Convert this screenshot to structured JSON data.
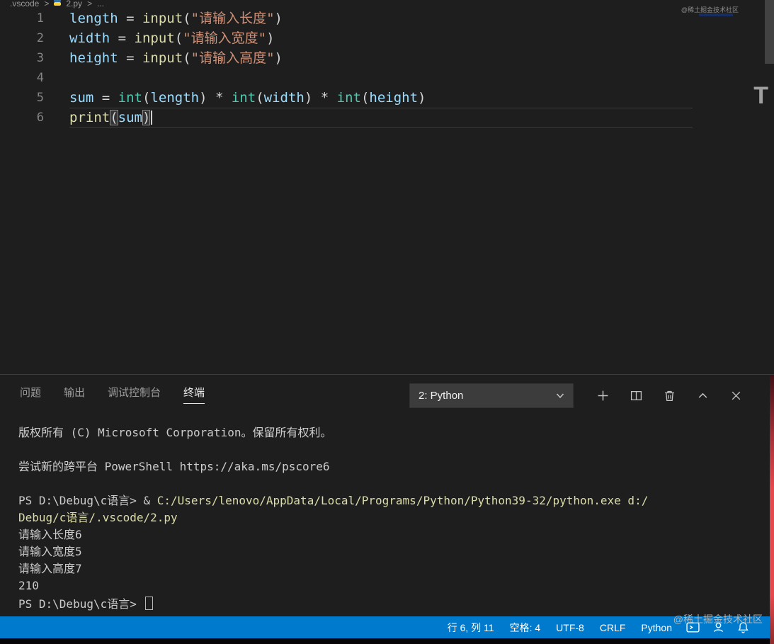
{
  "breadcrumb": {
    "folder": ".vscode",
    "sep": ">",
    "file": "2.py",
    "more": "..."
  },
  "editor": {
    "lines": [
      {
        "num": "1",
        "tokens": [
          {
            "t": "length",
            "c": "v"
          },
          {
            "t": " = ",
            "c": "o"
          },
          {
            "t": "input",
            "c": "f"
          },
          {
            "t": "(",
            "c": "p"
          },
          {
            "t": "\"请输入长度\"",
            "c": "s"
          },
          {
            "t": ")",
            "c": "p"
          }
        ]
      },
      {
        "num": "2",
        "tokens": [
          {
            "t": "width",
            "c": "v"
          },
          {
            "t": " = ",
            "c": "o"
          },
          {
            "t": "input",
            "c": "f"
          },
          {
            "t": "(",
            "c": "p"
          },
          {
            "t": "\"请输入宽度\"",
            "c": "s"
          },
          {
            "t": ")",
            "c": "p"
          }
        ]
      },
      {
        "num": "3",
        "tokens": [
          {
            "t": "height",
            "c": "v"
          },
          {
            "t": " = ",
            "c": "o"
          },
          {
            "t": "input",
            "c": "f"
          },
          {
            "t": "(",
            "c": "p"
          },
          {
            "t": "\"请输入高度\"",
            "c": "s"
          },
          {
            "t": ")",
            "c": "p"
          }
        ]
      },
      {
        "num": "4",
        "tokens": []
      },
      {
        "num": "5",
        "tokens": [
          {
            "t": "sum",
            "c": "v"
          },
          {
            "t": " = ",
            "c": "o"
          },
          {
            "t": "int",
            "c": "t"
          },
          {
            "t": "(",
            "c": "p"
          },
          {
            "t": "length",
            "c": "v"
          },
          {
            "t": ")",
            "c": "p"
          },
          {
            "t": " * ",
            "c": "o"
          },
          {
            "t": "int",
            "c": "t"
          },
          {
            "t": "(",
            "c": "p"
          },
          {
            "t": "width",
            "c": "v"
          },
          {
            "t": ")",
            "c": "p"
          },
          {
            "t": " * ",
            "c": "o"
          },
          {
            "t": "int",
            "c": "t"
          },
          {
            "t": "(",
            "c": "p"
          },
          {
            "t": "height",
            "c": "v"
          },
          {
            "t": ")",
            "c": "p"
          }
        ]
      },
      {
        "num": "6",
        "current": true,
        "cursor": true,
        "tokens": [
          {
            "t": "print",
            "c": "f"
          },
          {
            "t": "(",
            "c": "p",
            "hl": true
          },
          {
            "t": "sum",
            "c": "v"
          },
          {
            "t": ")",
            "c": "p",
            "hl": true
          }
        ]
      }
    ]
  },
  "panel": {
    "tabs": [
      {
        "label": "问题"
      },
      {
        "label": "输出"
      },
      {
        "label": "调试控制台"
      },
      {
        "label": "终端"
      }
    ],
    "terminal_select": {
      "value": "2: Python"
    }
  },
  "terminal": {
    "lines": [
      {
        "segments": [
          {
            "t": "版权所有 (C) Microsoft Corporation。保留所有权利。",
            "c": "d"
          }
        ]
      },
      {
        "segments": []
      },
      {
        "segments": [
          {
            "t": "尝试新的跨平台 PowerShell https://aka.ms/pscore6",
            "c": "d"
          }
        ]
      },
      {
        "segments": []
      },
      {
        "segments": [
          {
            "t": "PS D:\\Debug\\c语言> ",
            "c": "d"
          },
          {
            "t": "& ",
            "c": "d"
          },
          {
            "t": "C:/Users/lenovo/AppData/Local/Programs/Python/Python39-32/python.exe",
            "c": "y"
          },
          {
            "t": " d:/",
            "c": "y"
          }
        ]
      },
      {
        "segments": [
          {
            "t": "Debug/c语言/.vscode/2.py",
            "c": "y"
          }
        ]
      },
      {
        "segments": [
          {
            "t": "请输入长度6",
            "c": "d"
          }
        ]
      },
      {
        "segments": [
          {
            "t": "请输入宽度5",
            "c": "d"
          }
        ]
      },
      {
        "segments": [
          {
            "t": "请输入高度7",
            "c": "d"
          }
        ]
      },
      {
        "segments": [
          {
            "t": "210",
            "c": "d"
          }
        ]
      },
      {
        "segments": [
          {
            "t": "PS D:\\Debug\\c语言> ",
            "c": "d"
          }
        ],
        "cursor": true
      }
    ]
  },
  "statusbar": {
    "line_col": "行 6, 列 11",
    "spaces": "空格: 4",
    "encoding": "UTF-8",
    "eol": "CRLF",
    "language": "Python"
  },
  "watermarks": {
    "top_right": "@稀土掘金技术社区",
    "bottom_right": "@稀土掘金技术社区",
    "letter": "T"
  },
  "colors": {
    "statusbar_bg": "#007acc",
    "editor_bg": "#1e1e1e",
    "string": "#ce9178",
    "function": "#dcdcaa",
    "builtin_type": "#4ec9b0",
    "variable": "#9cdcfe",
    "terminal_command": "#dcdcaa",
    "side_strip": "#e5484d"
  }
}
